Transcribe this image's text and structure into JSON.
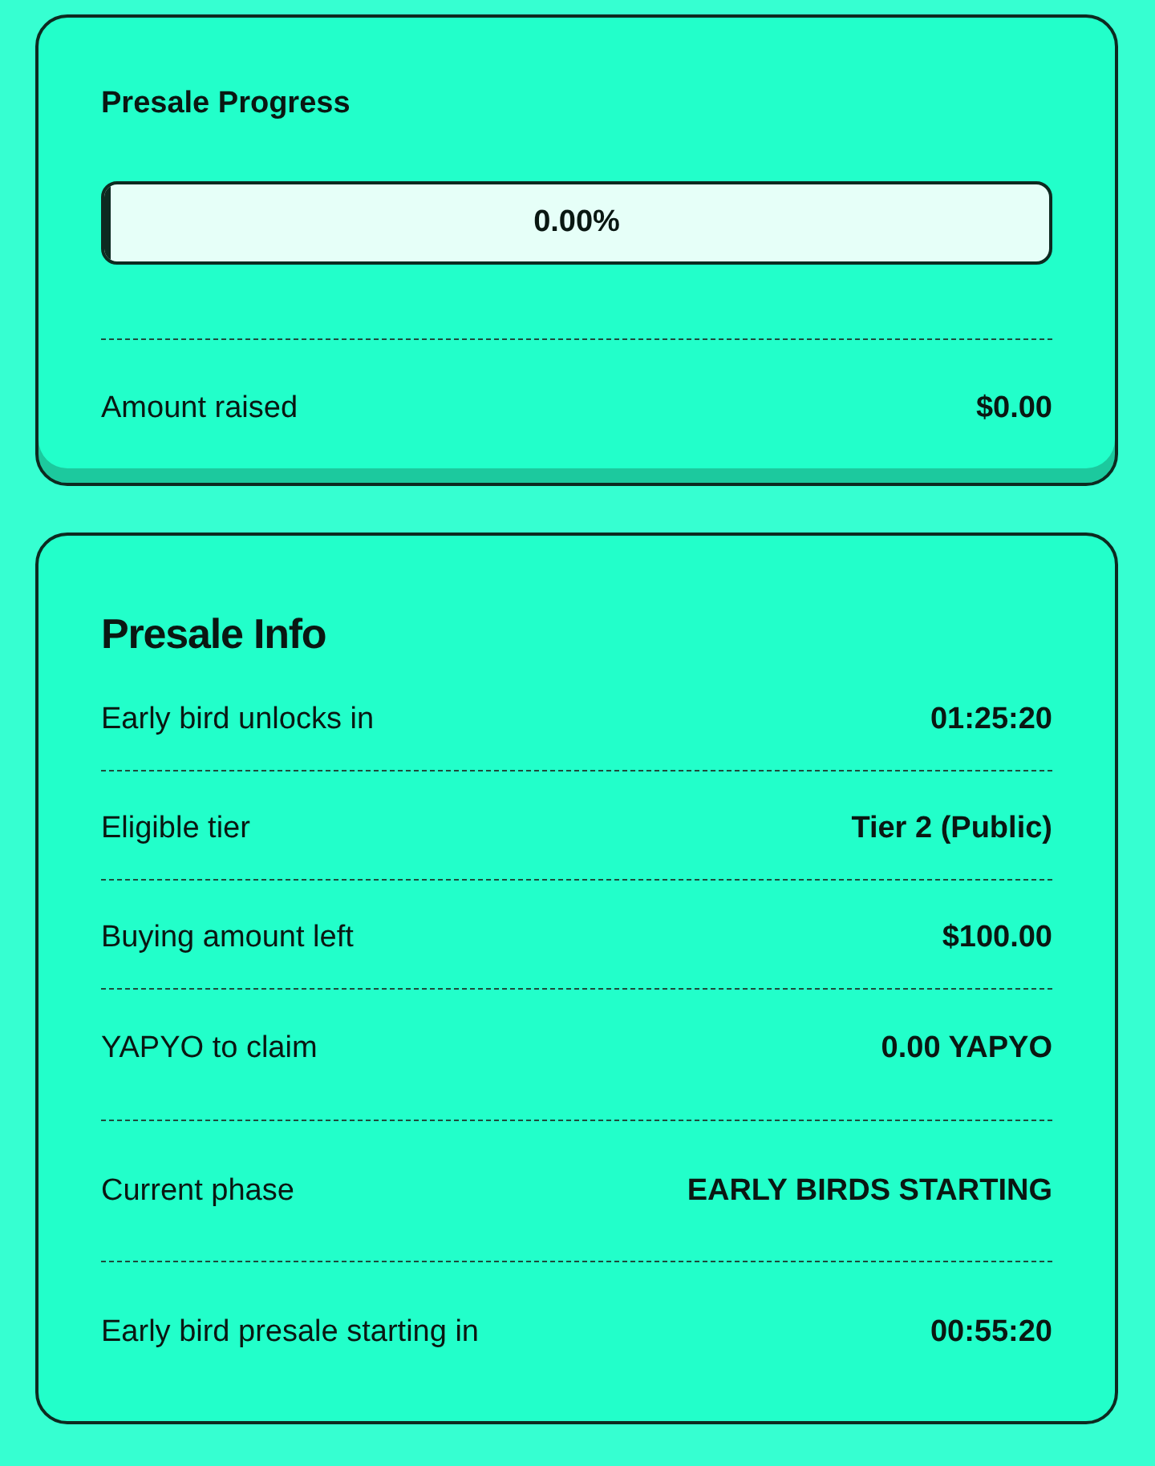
{
  "progress_card": {
    "title": "Presale Progress",
    "progress": {
      "level": 0,
      "label": "0.00%"
    },
    "rows": [
      {
        "label": "Amount raised",
        "value": "$0.00"
      }
    ]
  },
  "info_card": {
    "title": "Presale Info",
    "rows": [
      {
        "label": "Early bird unlocks in",
        "value": "01:25:20"
      },
      {
        "label": "Eligible tier",
        "value": "Tier 2 (Public)"
      },
      {
        "label": "Buying amount left",
        "value": "$100.00"
      },
      {
        "label": "YAPYO to claim",
        "value": "0.00 YAPYO"
      },
      {
        "label": "Current phase",
        "value": "EARLY BIRDS STARTING"
      },
      {
        "label": "Early bird presale starting in",
        "value": "00:55:20"
      }
    ]
  }
}
